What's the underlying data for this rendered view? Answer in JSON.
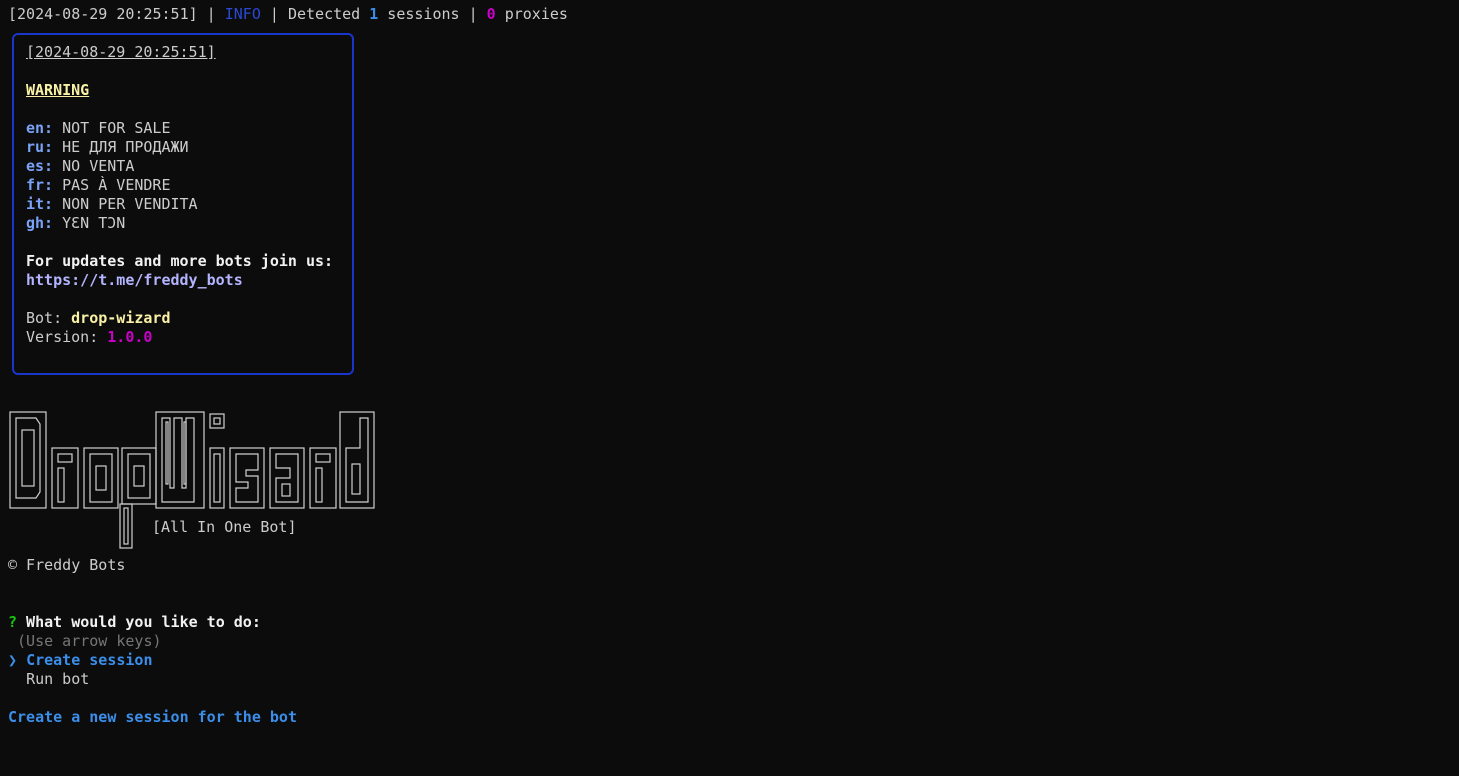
{
  "status_line": {
    "timestamp": "[2024-08-29 20:25:51]",
    "sep1": " | ",
    "level": "INFO",
    "sep2": " | ",
    "detected_text": "Detected ",
    "sessions_count": "1",
    "sessions_text": " sessions | ",
    "proxies_count": "0",
    "proxies_text": " proxies"
  },
  "warning_box": {
    "timestamp": "[2024-08-29 20:25:51]",
    "title": "WARNING",
    "notices": [
      {
        "lang": "en:",
        "text": " NOT FOR SALE"
      },
      {
        "lang": "ru:",
        "text": " НЕ ДЛЯ ПРОДАЖИ"
      },
      {
        "lang": "es:",
        "text": " NO VENTA"
      },
      {
        "lang": "fr:",
        "text": " PAS À VENDRE"
      },
      {
        "lang": "it:",
        "text": " NON PER VENDITA"
      },
      {
        "lang": "gh:",
        "text": " YƐN TƆN"
      }
    ],
    "join_text": "For updates and more bots join us:",
    "link": "https://t.me/freddy_bots",
    "bot_label": "Bot: ",
    "bot_name": "drop-wizard",
    "version_label": "Version: ",
    "version": "1.0.0"
  },
  "logo": {
    "name": "DropWizard",
    "subtitle": "[All In One Bot]",
    "copyright": "© Freddy Bots"
  },
  "prompt": {
    "marker": "?",
    "question": " What would you like to do:",
    "hint": " (Use arrow keys)",
    "pointer": "❯",
    "options": [
      {
        "label": "Create session",
        "selected": true
      },
      {
        "label": "Run bot",
        "selected": false
      }
    ],
    "description": "Create a new session for the bot"
  },
  "colors": {
    "background": "#0c0c0c",
    "info_blue": "#2a49d6",
    "number_blue": "#3b8eea",
    "magenta": "#c800c8",
    "warning_yellow": "#f9f1a5",
    "link": "#b4b4ff",
    "box_border": "#1a35c9",
    "prompt_green": "#16c60c"
  }
}
